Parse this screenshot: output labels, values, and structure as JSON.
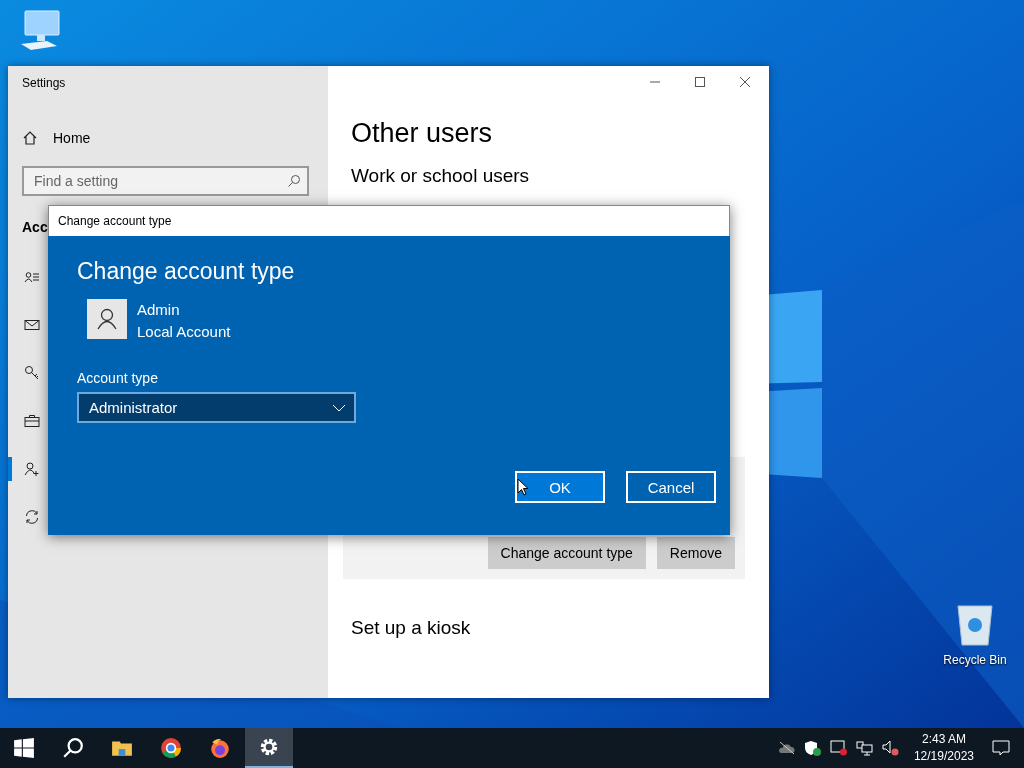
{
  "settings_window": {
    "title": "Settings",
    "sidebar": {
      "home": "Home",
      "search": {
        "placeholder": "Find a setting"
      },
      "section_heading": "Acc",
      "nav_items": [
        {
          "selected": false
        },
        {
          "selected": false
        },
        {
          "selected": false
        },
        {
          "selected": false
        },
        {
          "selected": true
        },
        {
          "selected": false
        }
      ]
    },
    "content": {
      "heading": "Other users",
      "subheading": "Work or school users",
      "buttons": [
        "Change account type",
        "Remove"
      ],
      "kiosk_heading": "Set up a kiosk"
    }
  },
  "dialog": {
    "title": "Change account type",
    "heading": "Change account type",
    "user": {
      "name": "Admin",
      "type": "Local Account"
    },
    "field_label": "Account type",
    "field_value": "Administrator",
    "buttons": [
      {
        "label": "OK",
        "default": true
      },
      {
        "label": "Cancel",
        "default": false
      }
    ]
  },
  "desktop": {
    "icons": [
      {
        "label": "Recycle Bin"
      }
    ]
  },
  "taskbar": {
    "apps": [
      {
        "active": false
      },
      {
        "active": false
      },
      {
        "active": false
      },
      {
        "active": false
      },
      {
        "active": false
      },
      {
        "active": true
      }
    ],
    "clock": {
      "time": "2:43 AM",
      "date": "12/19/2023"
    }
  }
}
